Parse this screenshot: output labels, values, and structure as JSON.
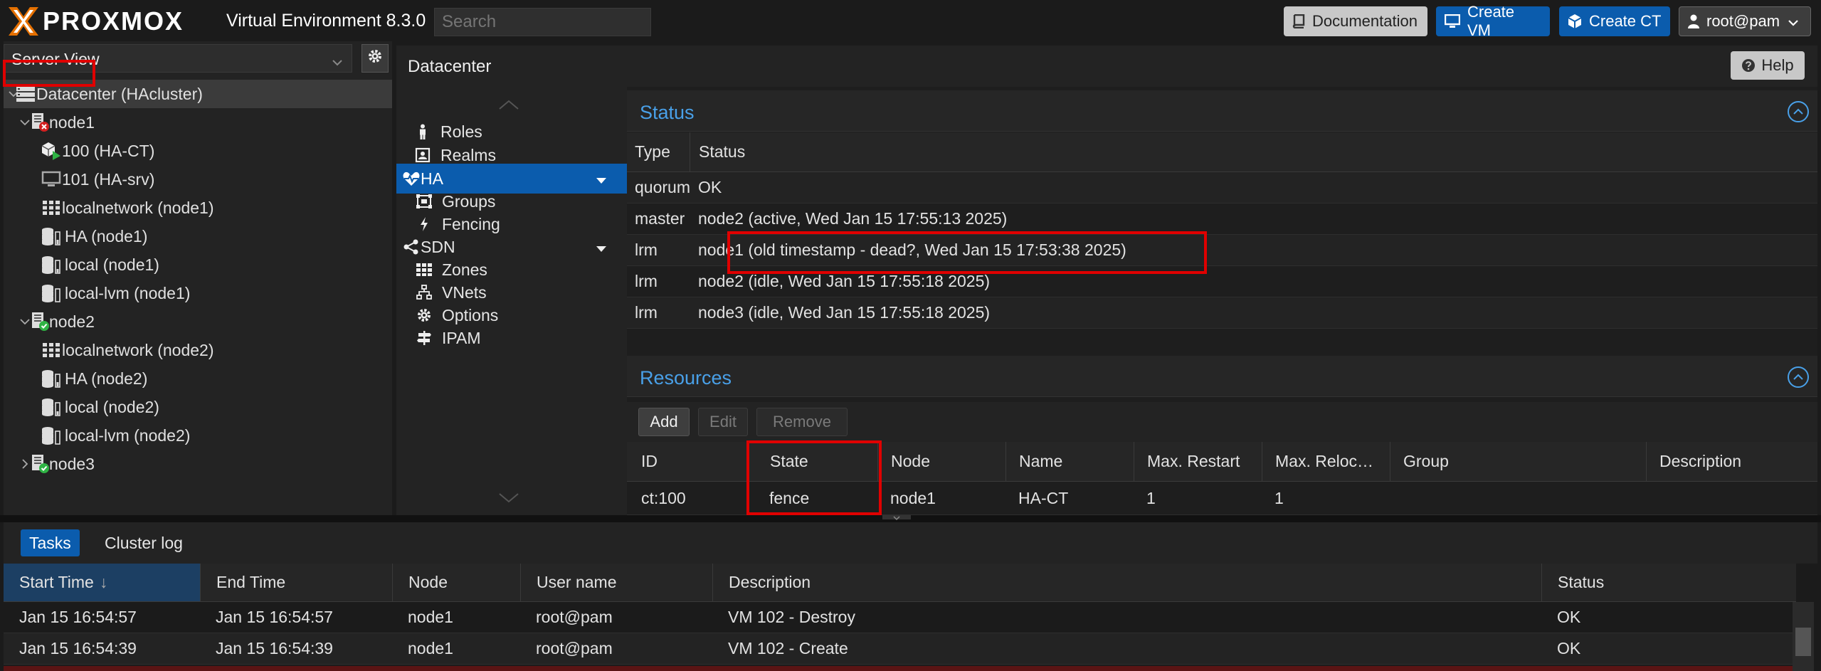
{
  "topbar": {
    "logo_text": "PROXMOX",
    "product": "Virtual Environment 8.3.0",
    "search_placeholder": "Search",
    "documentation": "Documentation",
    "create_vm": "Create VM",
    "create_ct": "Create CT",
    "user": "root@pam"
  },
  "left": {
    "view": "Server View",
    "tree": [
      {
        "label": "Datacenter (HAcluster)",
        "icon": "datacenter-icon",
        "twisty": "expanded"
      },
      {
        "label": "node1",
        "icon": "node-offline-icon",
        "twisty": "expanded"
      },
      {
        "label": "100 (HA-CT)",
        "icon": "container-running-icon",
        "twisty": ""
      },
      {
        "label": "101 (HA-srv)",
        "icon": "vm-icon",
        "twisty": ""
      },
      {
        "label": "localnetwork (node1)",
        "icon": "sdn-zone-icon",
        "twisty": ""
      },
      {
        "label": "HA (node1)",
        "icon": "storage-icon",
        "twisty": ""
      },
      {
        "label": "local (node1)",
        "icon": "storage-icon",
        "twisty": ""
      },
      {
        "label": "local-lvm (node1)",
        "icon": "storage-icon",
        "twisty": ""
      },
      {
        "label": "node2",
        "icon": "node-online-icon",
        "twisty": "expanded"
      },
      {
        "label": "localnetwork (node2)",
        "icon": "sdn-zone-icon",
        "twisty": ""
      },
      {
        "label": "HA (node2)",
        "icon": "storage-icon",
        "twisty": ""
      },
      {
        "label": "local (node2)",
        "icon": "storage-icon",
        "twisty": ""
      },
      {
        "label": "local-lvm (node2)",
        "icon": "storage-icon",
        "twisty": ""
      },
      {
        "label": "node3",
        "icon": "node-online-icon",
        "twisty": "collapsed"
      }
    ]
  },
  "main": {
    "title": "Datacenter",
    "help": "Help"
  },
  "nav": [
    {
      "label": "Roles",
      "icon": "roles-icon"
    },
    {
      "label": "Realms",
      "icon": "realms-icon"
    },
    {
      "label": "HA",
      "icon": "heartbeat-icon",
      "selected": true,
      "expander": true
    },
    {
      "label": "Groups",
      "icon": "groups-icon"
    },
    {
      "label": "Fencing",
      "icon": "fencing-icon"
    },
    {
      "label": "SDN",
      "icon": "sdn-icon",
      "expander": true
    },
    {
      "label": "Zones",
      "icon": "zones-icon"
    },
    {
      "label": "VNets",
      "icon": "vnets-icon"
    },
    {
      "label": "Options",
      "icon": "options-icon"
    },
    {
      "label": "IPAM",
      "icon": "ipam-icon"
    }
  ],
  "status": {
    "title": "Status",
    "columns": [
      "Type",
      "Status"
    ],
    "rows": [
      {
        "type": "quorum",
        "status": "OK"
      },
      {
        "type": "master",
        "status": "node2 (active, Wed Jan 15 17:55:13 2025)"
      },
      {
        "type": "lrm",
        "status": "node1 (old timestamp - dead?, Wed Jan 15 17:53:38 2025)"
      },
      {
        "type": "lrm",
        "status": "node2 (idle, Wed Jan 15 17:55:18 2025)"
      },
      {
        "type": "lrm",
        "status": "node3 (idle, Wed Jan 15 17:55:18 2025)"
      }
    ]
  },
  "resources": {
    "title": "Resources",
    "buttons": {
      "add": "Add",
      "edit": "Edit",
      "remove": "Remove"
    },
    "columns": [
      "ID",
      "State",
      "Node",
      "Name",
      "Max. Restart",
      "Max. Reloc…",
      "Group",
      "Description"
    ],
    "rows": [
      {
        "id": "ct:100",
        "state": "fence",
        "node": "node1",
        "name": "HA-CT",
        "max_restart": "1",
        "max_reloc": "1",
        "group": "",
        "description": ""
      }
    ]
  },
  "tasks": {
    "tabs": [
      "Tasks",
      "Cluster log"
    ],
    "columns": [
      "Start Time",
      "End Time",
      "Node",
      "User name",
      "Description",
      "Status"
    ],
    "sort_indicator": "↓",
    "rows": [
      {
        "start": "Jan 15 16:54:57",
        "end": "Jan 15 16:54:57",
        "node": "node1",
        "user": "root@pam",
        "desc": "VM 102 - Destroy",
        "status": "OK"
      },
      {
        "start": "Jan 15 16:54:39",
        "end": "Jan 15 16:54:39",
        "node": "node1",
        "user": "root@pam",
        "desc": "VM 102 - Create",
        "status": "OK"
      }
    ]
  },
  "colors": {
    "accent": "#0b5cad",
    "section_title": "#49a0e8",
    "highlight": "#e00000",
    "online": "#2fb344",
    "offline": "#d32020"
  }
}
